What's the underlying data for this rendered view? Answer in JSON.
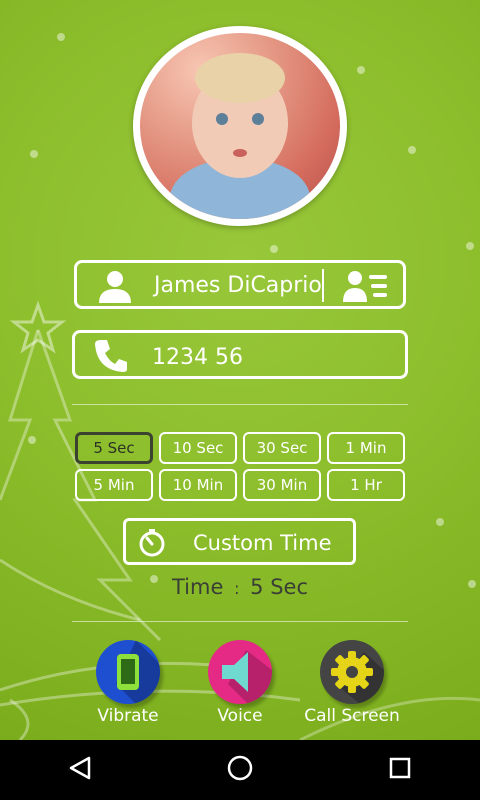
{
  "contact": {
    "name": "James DiCaprio",
    "number": "1234 56"
  },
  "timers": {
    "row1": [
      "5 Sec",
      "10 Sec",
      "30 Sec",
      "1 Min"
    ],
    "row2": [
      "5 Min",
      "10 Min",
      "30 Min",
      "1 Hr"
    ],
    "selected": "5 Sec"
  },
  "custom_time": {
    "label": "Custom Time"
  },
  "status": {
    "prefix": "Time",
    "separator": ":",
    "value": "5 Sec"
  },
  "actions": {
    "vibrate": {
      "label": "Vibrate",
      "color": "#1f4fd1"
    },
    "voice": {
      "label": "Voice",
      "color": "#e52a86"
    },
    "call_screen": {
      "label": "Call Screen",
      "color": "#444444"
    }
  },
  "nav": {
    "back_icon": "back-icon",
    "home_icon": "home-icon",
    "recents_icon": "recents-icon"
  },
  "colors": {
    "background": "#8dbe2c",
    "accent": "#ffffff",
    "nav_bar": "#000000"
  }
}
